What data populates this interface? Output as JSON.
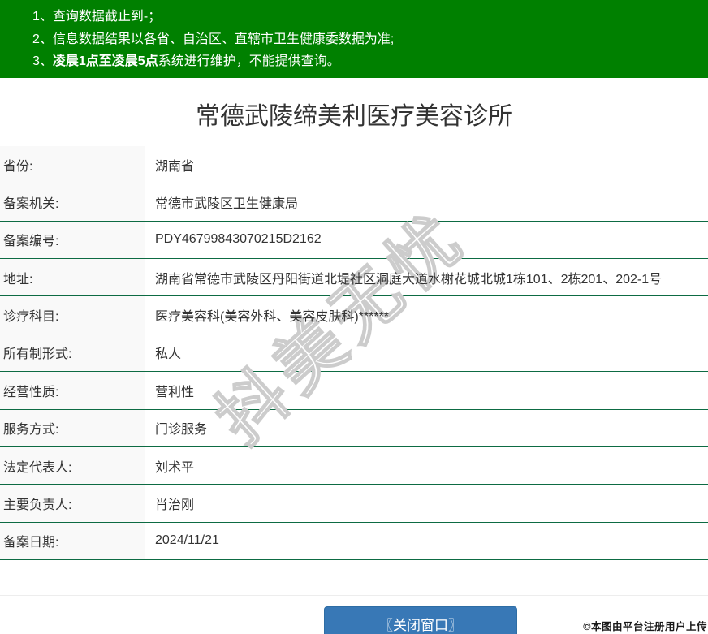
{
  "notices": [
    {
      "prefix": "1、",
      "bold": "",
      "text": "查询数据截止到-；"
    },
    {
      "prefix": "2、",
      "bold": "",
      "text": "信息数据结果以各省、自治区、直辖市卫生健康委数据为准;"
    },
    {
      "prefix": "3、",
      "bold": "凌晨1点至凌晨5点",
      "text": "系统进行维护，不能提供查询。"
    }
  ],
  "title": "常德武陵缔美利医疗美容诊所",
  "table": {
    "rows": [
      {
        "label": "省份:",
        "value": "湖南省"
      },
      {
        "label": "备案机关:",
        "value": "常德市武陵区卫生健康局"
      },
      {
        "label": "备案编号:",
        "value": "PDY46799843070215D2162"
      },
      {
        "label": "地址:",
        "value": "湖南省常德市武陵区丹阳街道北堤社区洞庭大道水榭花城北城1栋101、2栋201、202-1号"
      },
      {
        "label": "诊疗科目:",
        "value": "医疗美容科(美容外科、美容皮肤科)******"
      },
      {
        "label": "所有制形式:",
        "value": "私人"
      },
      {
        "label": "经营性质:",
        "value": "营利性"
      },
      {
        "label": "服务方式:",
        "value": "门诊服务"
      },
      {
        "label": "法定代表人:",
        "value": "刘术平"
      },
      {
        "label": "主要负责人:",
        "value": "肖治刚"
      },
      {
        "label": "备案日期:",
        "value": "2024/11/21"
      }
    ]
  },
  "watermark_text": "抖美无忧",
  "footer": {
    "close_button": "〖关闭窗口〗",
    "copyright": "©本图由平台注册用户上传"
  },
  "colors": {
    "banner_green": "#008000",
    "table_border_green": "#0d6b43",
    "button_blue": "#3878b6",
    "label_bg": "#f9f9f9"
  }
}
